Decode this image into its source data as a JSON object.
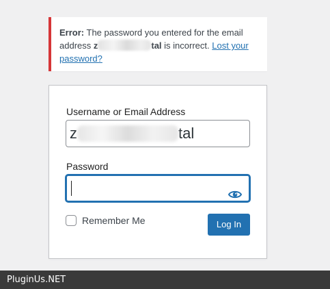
{
  "notice": {
    "error_label": "Error:",
    "message_part1": "The password you entered for the email address",
    "email_visible_start": "z",
    "email_visible_end": "tal",
    "message_part2": "is incorrect.",
    "lost_password_link": "Lost your password?"
  },
  "form": {
    "username_label": "Username or Email Address",
    "username_value_start": "z",
    "username_value_end": "tal",
    "password_label": "Password",
    "password_value": "",
    "remember_label": "Remember Me",
    "remember_checked": false,
    "login_button": "Log In",
    "show_password_icon": "eye-icon"
  },
  "footer": {
    "watermark": "PluginUs.NET"
  },
  "colors": {
    "error_border": "#d63638",
    "accent": "#2271b1",
    "background": "#f0f0f1",
    "footer_bg": "#3a3a3a"
  }
}
